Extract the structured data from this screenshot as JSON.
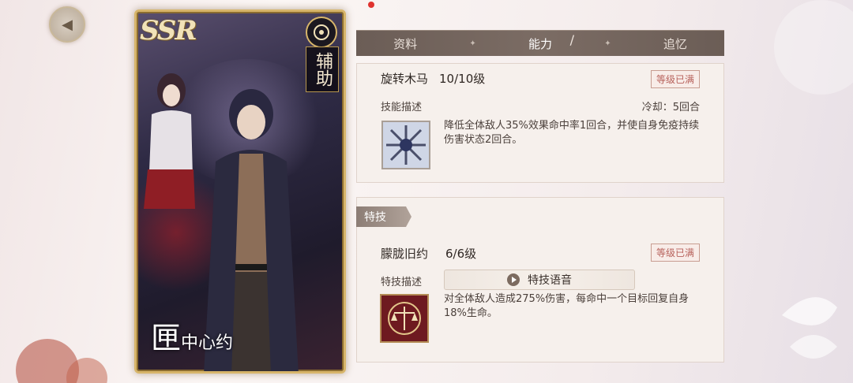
{
  "nav": {
    "back_icon": "back-icon"
  },
  "card": {
    "rarity": "SSR",
    "class_label": "辅助",
    "char_name_big": "匣",
    "char_name_small": "中心约",
    "class_icon": "support-class-icon"
  },
  "tabs": [
    {
      "label": "资料",
      "active": false
    },
    {
      "label": "能力",
      "active": true
    },
    {
      "label": "追忆",
      "active": false
    }
  ],
  "skill": {
    "name": "旋转木马",
    "level": "10/10级",
    "maxed_badge": "等级已满",
    "desc_label": "技能描述",
    "cooldown": "冷却：5回合",
    "description": "降低全体敌人35%效果命中率1回合，并使自身免疫持续伤害状态2回合。"
  },
  "special": {
    "header": "特技",
    "name": "朦胧旧约",
    "level": "6/6级",
    "maxed_badge": "等级已满",
    "desc_label": "特技描述",
    "voice_button": "特技语音",
    "description": "对全体敌人造成275%伤害，每命中一个目标回复自身18%生命。"
  },
  "colors": {
    "card_border": "#d7b56a",
    "tab_bar": "#6b5d56",
    "badge_text": "#b7615b",
    "panel_bg": "#f6f0ec"
  }
}
